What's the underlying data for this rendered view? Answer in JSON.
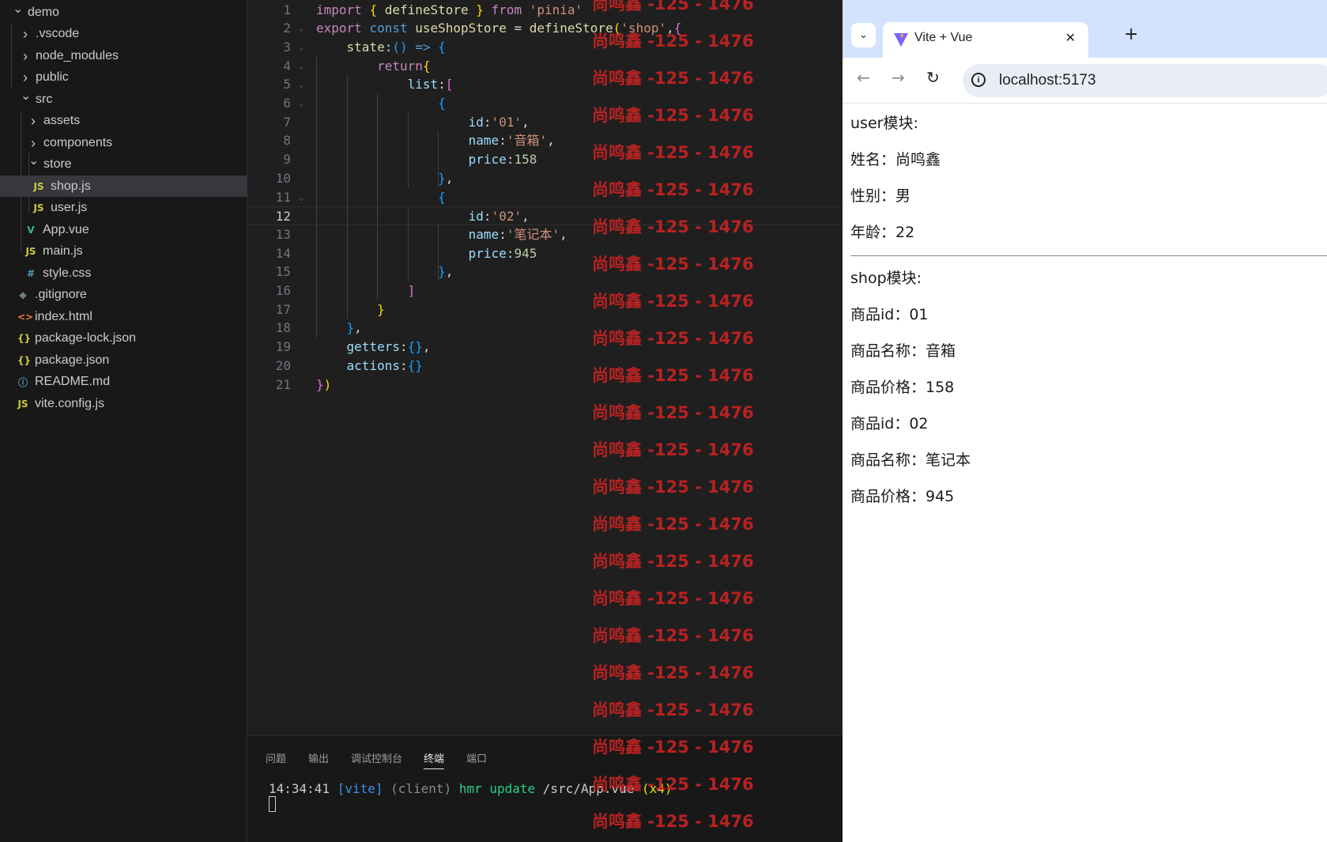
{
  "explorer": {
    "items": [
      {
        "label": "demo",
        "chevron": "v",
        "icon": "",
        "icon_color": ""
      },
      {
        "label": ".vscode",
        "chevron": ">",
        "icon": "",
        "icon_color": ""
      },
      {
        "label": "node_modules",
        "chevron": ">",
        "icon": "",
        "icon_color": ""
      },
      {
        "label": "public",
        "chevron": ">",
        "icon": "",
        "icon_color": ""
      },
      {
        "label": "src",
        "chevron": "v",
        "icon": "",
        "icon_color": ""
      },
      {
        "label": "assets",
        "chevron": ">",
        "icon": "",
        "icon_color": ""
      },
      {
        "label": "components",
        "chevron": ">",
        "icon": "",
        "icon_color": ""
      },
      {
        "label": "store",
        "chevron": "v",
        "icon": "",
        "icon_color": ""
      },
      {
        "label": "shop.js",
        "chevron": "",
        "icon": "JS",
        "icon_color": "#cbcb41"
      },
      {
        "label": "user.js",
        "chevron": "",
        "icon": "JS",
        "icon_color": "#cbcb41"
      },
      {
        "label": "App.vue",
        "chevron": "",
        "icon": "V",
        "icon_color": "#41b883"
      },
      {
        "label": "main.js",
        "chevron": "",
        "icon": "JS",
        "icon_color": "#cbcb41"
      },
      {
        "label": "style.css",
        "chevron": "",
        "icon": "#",
        "icon_color": "#519aba"
      },
      {
        "label": ".gitignore",
        "chevron": "",
        "icon": "◆",
        "icon_color": "#6d8086"
      },
      {
        "label": "index.html",
        "chevron": "",
        "icon": "<>",
        "icon_color": "#e37933"
      },
      {
        "label": "package-lock.json",
        "chevron": "",
        "icon": "{}",
        "icon_color": "#cbcb41"
      },
      {
        "label": "package.json",
        "chevron": "",
        "icon": "{}",
        "icon_color": "#cbcb41"
      },
      {
        "label": "README.md",
        "chevron": "",
        "icon": "ⓘ",
        "icon_color": "#519aba"
      },
      {
        "label": "vite.config.js",
        "chevron": "",
        "icon": "JS",
        "icon_color": "#cbcb41"
      }
    ]
  },
  "editor": {
    "current_line": 12,
    "lines": [
      {
        "n": "1",
        "tokens": [
          [
            "import ",
            "k"
          ],
          [
            "{ ",
            "b1"
          ],
          [
            "defineStore ",
            "f"
          ],
          [
            "} ",
            "b1"
          ],
          [
            "from ",
            "k"
          ],
          [
            "'pinia'",
            "s"
          ]
        ]
      },
      {
        "n": "2",
        "tokens": [
          [
            "export ",
            "k"
          ],
          [
            "const ",
            "kb"
          ],
          [
            "useShopStore ",
            "f"
          ],
          [
            "= ",
            "p"
          ],
          [
            "defineStore",
            "f"
          ],
          [
            "(",
            "b1"
          ],
          [
            "'shop'",
            "s"
          ],
          [
            ",",
            "p"
          ],
          [
            "{",
            "b2"
          ]
        ]
      },
      {
        "n": "3",
        "tokens": [
          [
            "    state",
            "f"
          ],
          [
            ":",
            "p"
          ],
          [
            "() ",
            "b3"
          ],
          [
            "=> ",
            "kb"
          ],
          [
            "{",
            "b3"
          ]
        ]
      },
      {
        "n": "4",
        "tokens": [
          [
            "        return",
            "k"
          ],
          [
            "{",
            "b1"
          ]
        ]
      },
      {
        "n": "5",
        "tokens": [
          [
            "            list",
            "v"
          ],
          [
            ":",
            "p"
          ],
          [
            "[",
            "b2"
          ]
        ]
      },
      {
        "n": "6",
        "tokens": [
          [
            "                {",
            "b3"
          ]
        ]
      },
      {
        "n": "7",
        "tokens": [
          [
            "                    id",
            "v"
          ],
          [
            ":",
            "p"
          ],
          [
            "'01'",
            "s"
          ],
          [
            ",",
            "p"
          ]
        ]
      },
      {
        "n": "8",
        "tokens": [
          [
            "                    name",
            "v"
          ],
          [
            ":",
            "p"
          ],
          [
            "'音箱'",
            "s"
          ],
          [
            ",",
            "p"
          ]
        ]
      },
      {
        "n": "9",
        "tokens": [
          [
            "                    price",
            "v"
          ],
          [
            ":",
            "p"
          ],
          [
            "158",
            "n"
          ]
        ]
      },
      {
        "n": "10",
        "tokens": [
          [
            "                }",
            "b3"
          ],
          [
            ",",
            "p"
          ]
        ]
      },
      {
        "n": "11",
        "tokens": [
          [
            "                {",
            "b3"
          ]
        ]
      },
      {
        "n": "12",
        "tokens": [
          [
            "                    id",
            "v"
          ],
          [
            ":",
            "p"
          ],
          [
            "'02'",
            "s"
          ],
          [
            ",",
            "p"
          ]
        ]
      },
      {
        "n": "13",
        "tokens": [
          [
            "                    name",
            "v"
          ],
          [
            ":",
            "p"
          ],
          [
            "'笔记本'",
            "s"
          ],
          [
            ",",
            "p"
          ]
        ]
      },
      {
        "n": "14",
        "tokens": [
          [
            "                    price",
            "v"
          ],
          [
            ":",
            "p"
          ],
          [
            "945",
            "n"
          ]
        ]
      },
      {
        "n": "15",
        "tokens": [
          [
            "                }",
            "b3"
          ],
          [
            ",",
            "p"
          ]
        ]
      },
      {
        "n": "16",
        "tokens": [
          [
            "            ]",
            "b2"
          ]
        ]
      },
      {
        "n": "17",
        "tokens": [
          [
            "        }",
            "b1"
          ]
        ]
      },
      {
        "n": "18",
        "tokens": [
          [
            "    }",
            "b3"
          ],
          [
            ",",
            "p"
          ]
        ]
      },
      {
        "n": "19",
        "tokens": [
          [
            "    getters",
            "v"
          ],
          [
            ":",
            "p"
          ],
          [
            "{}",
            "b3"
          ],
          [
            ",",
            "p"
          ]
        ]
      },
      {
        "n": "20",
        "tokens": [
          [
            "    actions",
            "v"
          ],
          [
            ":",
            "p"
          ],
          [
            "{}",
            "b3"
          ]
        ]
      },
      {
        "n": "21",
        "tokens": [
          [
            "}",
            "b2"
          ],
          [
            ")",
            "b1"
          ]
        ]
      }
    ]
  },
  "panel": {
    "tabs": [
      "问题",
      "输出",
      "调试控制台",
      "终端",
      "端口"
    ],
    "active_tab": "终端",
    "terminal": [
      [
        "14:34:41 ",
        "#cccccc"
      ],
      [
        "[vite]",
        "#3b8eea"
      ],
      [
        " (client) ",
        "#8a8a8a"
      ],
      [
        "hmr update ",
        "#23d18b"
      ],
      [
        "/src/App.vue ",
        "#cccccc"
      ],
      [
        "(x4)",
        "#e5e510"
      ]
    ]
  },
  "watermark": {
    "text": "尚鸣鑫 -125 - 1476",
    "count": 23
  },
  "browser": {
    "tab_title": "Vite + Vue",
    "url": "localhost:5173",
    "content": {
      "user_heading": "user模块:",
      "name": "姓名：尚鸣鑫",
      "gender": "性别：男",
      "age": "年龄：22",
      "shop_heading": "shop模块:",
      "items": [
        "商品id：01",
        "商品名称：音箱",
        "商品价格：158",
        "商品id：02",
        "商品名称：笔记本",
        "商品价格：945"
      ]
    }
  }
}
